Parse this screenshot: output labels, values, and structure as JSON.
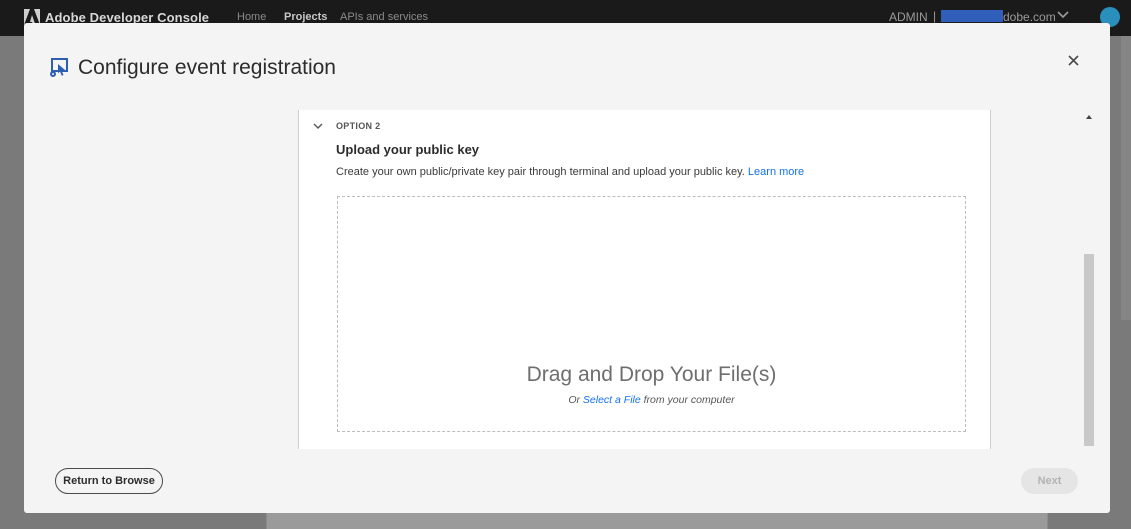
{
  "topbar": {
    "app_title": "Adobe Developer Console",
    "nav": [
      "Home",
      "Projects",
      "APIs and services"
    ],
    "org": "ADMIN",
    "separator": "|",
    "email_suffix": "dobe.com",
    "avatar_color": "#2a8fbd"
  },
  "dialog": {
    "title": "Configure event registration",
    "close_icon": "close-icon"
  },
  "option": {
    "label": "OPTION 2",
    "title": "Upload your public key",
    "description": "Create your own public/private key pair through terminal and upload your public key.",
    "learn_more": "Learn more"
  },
  "dropzone": {
    "title": "Drag and Drop Your File(s)",
    "sub_prefix": "Or",
    "select_link": "Select a File",
    "sub_suffix": "from your computer"
  },
  "footer": {
    "return_label": "Return to Browse",
    "next_label": "Next"
  },
  "colors": {
    "accent": "#1473e6",
    "topbar_bg": "#1a1a1a"
  }
}
